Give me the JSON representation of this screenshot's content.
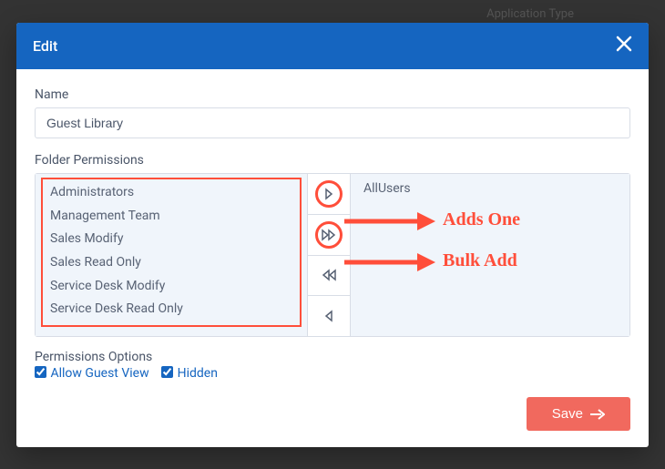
{
  "background": {
    "app_type_label": "Application Type"
  },
  "modal": {
    "title": "Edit",
    "name_label": "Name",
    "name_value": "Guest Library",
    "folder_perm_label": "Folder Permissions",
    "available": [
      "Administrators",
      "Management Team",
      "Sales Modify",
      "Sales Read Only",
      "Service Desk Modify",
      "Service Desk Read Only"
    ],
    "selected": [
      "AllUsers"
    ],
    "options_label": "Permissions Options",
    "allow_guest_label": "Allow Guest View",
    "allow_guest_checked": true,
    "hidden_label": "Hidden",
    "hidden_checked": true,
    "save_label": "Save"
  },
  "annotations": {
    "adds_one": "Adds One",
    "bulk_add": "Bulk Add"
  },
  "icons": {
    "close": "close-icon",
    "add_one": "chevron-right-icon",
    "add_all": "double-chevron-right-icon",
    "remove_all": "double-chevron-left-icon",
    "remove_one": "chevron-left-icon",
    "save_arrow": "arrow-right-icon"
  },
  "colors": {
    "accent": "#1565c0",
    "danger": "#f1695e",
    "highlight": "#ff4e3a"
  }
}
